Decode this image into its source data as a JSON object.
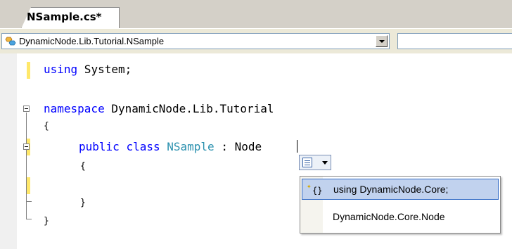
{
  "tab": {
    "title": "NSample.cs*"
  },
  "navbar": {
    "type_combo": "DynamicNode.Lib.Tutorial.NSample",
    "member_combo": ""
  },
  "code": {
    "line1": {
      "kw": "using",
      "rest": " System;"
    },
    "line2": {
      "kw": "namespace",
      "rest": " DynamicNode.Lib.Tutorial"
    },
    "line3": "{",
    "line4": {
      "kw1": "public",
      "kw2": "class",
      "type": "NSample",
      "rest": " : Node"
    },
    "line5": "{",
    "line7": "}",
    "line8": "}"
  },
  "smart_tag": {
    "icon": "smart-tag-icon"
  },
  "menu": {
    "items": [
      {
        "label": "using DynamicNode.Core;",
        "icon": "using-namespace-icon"
      },
      {
        "label": "DynamicNode.Core.Node"
      }
    ]
  }
}
